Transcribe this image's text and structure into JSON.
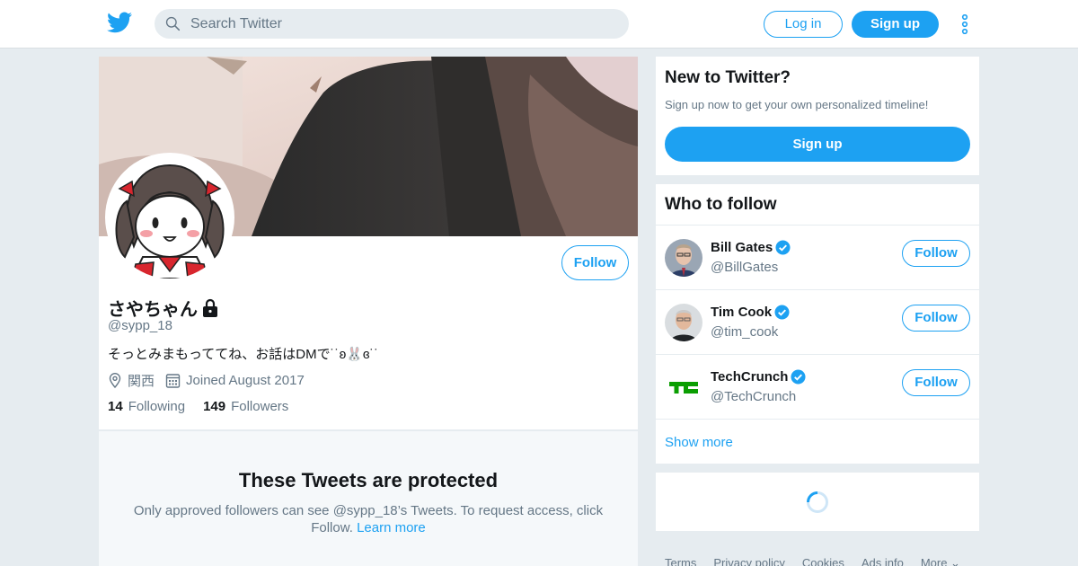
{
  "topbar": {
    "logo_icon": "twitter-bird-icon",
    "search_placeholder": "Search Twitter",
    "login_label": "Log in",
    "signup_label": "Sign up",
    "more_icon": "vertical-dots-icon"
  },
  "profile": {
    "name": "さやちゃん",
    "protected_icon": "lock-icon",
    "handle": "@sypp_18",
    "bio": "そっとみまもっててね、お話はDMで˙˙ʚ🐰ɞ˙˙",
    "location": "関西",
    "joined": "Joined August 2017",
    "following_count": "14",
    "following_label": "Following",
    "followers_count": "149",
    "followers_label": "Followers",
    "follow_label": "Follow"
  },
  "protected_notice": {
    "title": "These Tweets are protected",
    "text": "Only approved followers can see @sypp_18’s Tweets. To request access, click Follow.",
    "link": "Learn more"
  },
  "new_to_twitter": {
    "title": "New to Twitter?",
    "subtitle": "Sign up now to get your own personalized timeline!",
    "button": "Sign up"
  },
  "who_to_follow": {
    "title": "Who to follow",
    "accounts": [
      {
        "name": "Bill Gates",
        "handle": "@BillGates",
        "button": "Follow"
      },
      {
        "name": "Tim Cook",
        "handle": "@tim_cook",
        "button": "Follow"
      },
      {
        "name": "TechCrunch",
        "handle": "@TechCrunch",
        "button": "Follow"
      }
    ],
    "show_more": "Show more"
  },
  "footer": {
    "links": [
      "Terms",
      "Privacy policy",
      "Cookies",
      "Ads info",
      "More ⌄"
    ]
  },
  "colors": {
    "accent": "#1da1f2",
    "background": "#e6ecf0",
    "secondary_text": "#657786"
  }
}
